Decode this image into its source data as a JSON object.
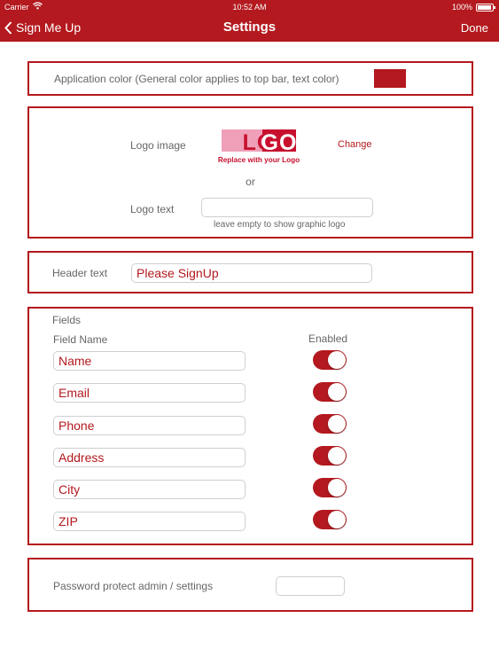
{
  "status_bar": {
    "carrier": "Carrier",
    "time": "10:52 AM",
    "battery": "100%"
  },
  "nav": {
    "back_label": "Sign Me Up",
    "title": "Settings",
    "done_label": "Done"
  },
  "app_color": {
    "label": "Application color (General color applies to top bar, text color)",
    "color": "#b3191e"
  },
  "logo": {
    "image_label": "Logo image",
    "change_label": "Change",
    "or_label": "or",
    "text_label": "Logo text",
    "text_value": "",
    "hint": "leave empty to show graphic logo"
  },
  "header": {
    "label": "Header text",
    "value": "Please SignUp"
  },
  "fields": {
    "section_label": "Fields",
    "col_name": "Field Name",
    "col_enabled": "Enabled",
    "rows": [
      {
        "name": "Name",
        "enabled": true
      },
      {
        "name": "Email",
        "enabled": true
      },
      {
        "name": "Phone",
        "enabled": true
      },
      {
        "name": "Address",
        "enabled": true
      },
      {
        "name": "City",
        "enabled": true
      },
      {
        "name": "ZIP",
        "enabled": true
      }
    ]
  },
  "password": {
    "label": "Password protect admin / settings",
    "value": ""
  },
  "colors": {
    "accent": "#b3191e",
    "logo_pink": "#ef9fb8",
    "logo_red": "#c8102e"
  }
}
